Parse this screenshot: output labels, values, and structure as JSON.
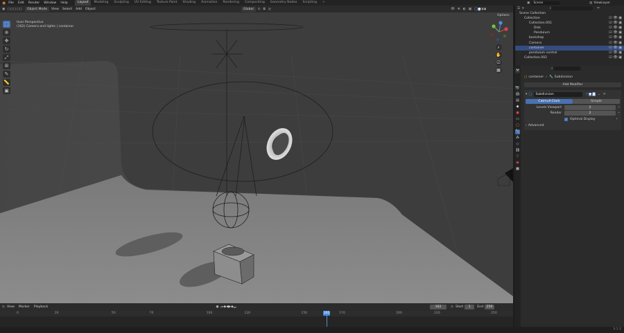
{
  "topbar": {
    "menus": [
      "File",
      "Edit",
      "Render",
      "Window",
      "Help"
    ],
    "workspaces": [
      "Layout",
      "Modeling",
      "Sculpting",
      "UV Editing",
      "Texture Paint",
      "Shading",
      "Animation",
      "Rendering",
      "Compositing",
      "Geometry Nodes",
      "Scripting"
    ],
    "active_workspace": "Layout",
    "scene": "Scene",
    "view_layer": "ViewLayer"
  },
  "viewport_header": {
    "mode": "Object Mode",
    "menus": [
      "View",
      "Select",
      "Add",
      "Object"
    ],
    "orientation": "Global",
    "options": "Options"
  },
  "viewport": {
    "view_name": "User Perspective",
    "info": "(162) Camera and lights | container"
  },
  "outliner": {
    "search_placeholder": "",
    "rows": [
      {
        "label": "Scene Collection",
        "indent": 0,
        "selected": false
      },
      {
        "label": "Collection",
        "indent": 1,
        "selected": false
      },
      {
        "label": "Collection.001",
        "indent": 2,
        "selected": false
      },
      {
        "label": "Disk",
        "indent": 3,
        "selected": false
      },
      {
        "label": "Pendulum",
        "indent": 3,
        "selected": false
      },
      {
        "label": "backdrop",
        "indent": 2,
        "selected": false
      },
      {
        "label": "Camera",
        "indent": 2,
        "selected": false
      },
      {
        "label": "container",
        "indent": 2,
        "selected": true
      },
      {
        "label": "pendulum control",
        "indent": 2,
        "selected": false
      },
      {
        "label": "Collection.002",
        "indent": 1,
        "selected": false
      }
    ]
  },
  "properties": {
    "object_name": "container",
    "breadcrumb_sep": "›",
    "modifier_context": "Subdivision",
    "add_modifier": "Add Modifier",
    "modifier_name": "Subdivision",
    "tabs": [
      "Catmull-Clark",
      "Simple"
    ],
    "active_tab": "Catmull-Clark",
    "levels_viewport_label": "Levels Viewport",
    "levels_viewport_value": "2",
    "render_label": "Render",
    "render_value": "2",
    "optimal_display": "Optimal Display",
    "advanced": "Advanced"
  },
  "timeline_header": {
    "menus": [
      "View",
      "Marker"
    ],
    "playback": "Playback",
    "current_frame": "162",
    "start_label": "Start",
    "start_value": "1",
    "end_label": "End",
    "end_value": "250"
  },
  "timeline": {
    "ticks": [
      "0",
      "20",
      "50",
      "70",
      "100",
      "120",
      "150",
      "170",
      "200",
      "220",
      "250"
    ],
    "current_frame": "162"
  },
  "statusbar": {
    "version": "3.1.2"
  },
  "colors": {
    "accent": "#4772b3",
    "selection": "#334d80",
    "playhead": "#4d8fdc"
  }
}
